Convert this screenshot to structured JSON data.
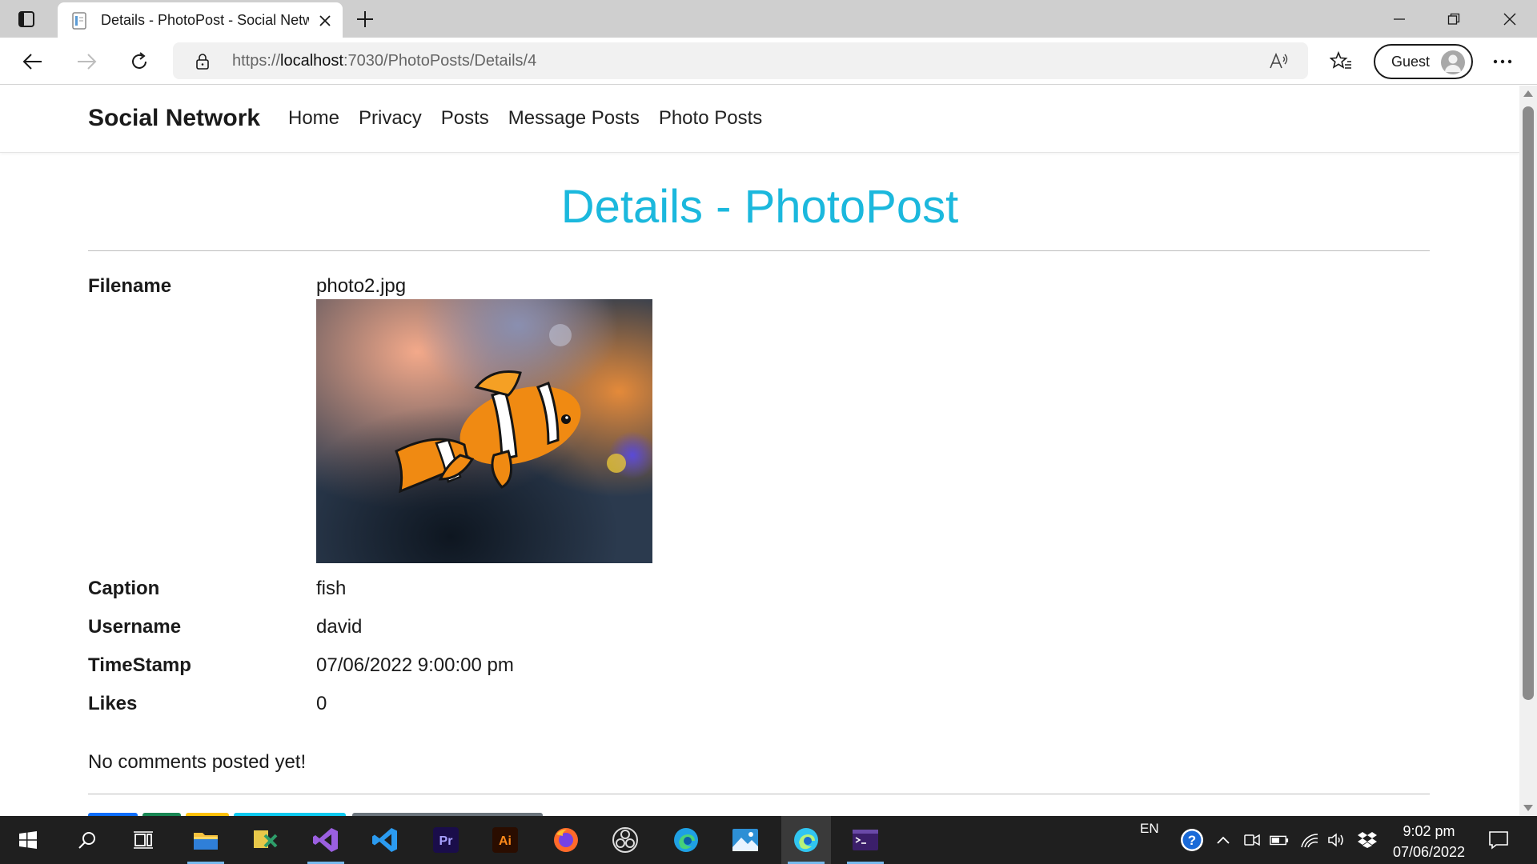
{
  "browser": {
    "tab_title": "Details - PhotoPost - Social Network",
    "url_scheme": "https://",
    "url_host": "localhost",
    "url_rest": ":7030/PhotoPosts/Details/4",
    "profile_label": "Guest"
  },
  "site": {
    "brand": "Social Network",
    "nav": [
      "Home",
      "Privacy",
      "Posts",
      "Message Posts",
      "Photo Posts"
    ]
  },
  "page": {
    "title": "Details - PhotoPost",
    "fields": [
      {
        "label": "Filename",
        "value": "photo2.jpg"
      },
      {
        "label": "Caption",
        "value": "fish"
      },
      {
        "label": "Username",
        "value": "david"
      },
      {
        "label": "TimeStamp",
        "value": "07/06/2022 9:00:00 pm"
      },
      {
        "label": "Likes",
        "value": "0"
      }
    ],
    "comments_text": "No comments posted yet!"
  },
  "taskbar": {
    "language": "EN",
    "time": "9:02 pm",
    "date": "07/06/2022"
  },
  "colors": {
    "title_accent": "#1bb8dd",
    "taskbar_bg": "#1f1f1f",
    "chrome_bg": "#cfcfcf"
  }
}
